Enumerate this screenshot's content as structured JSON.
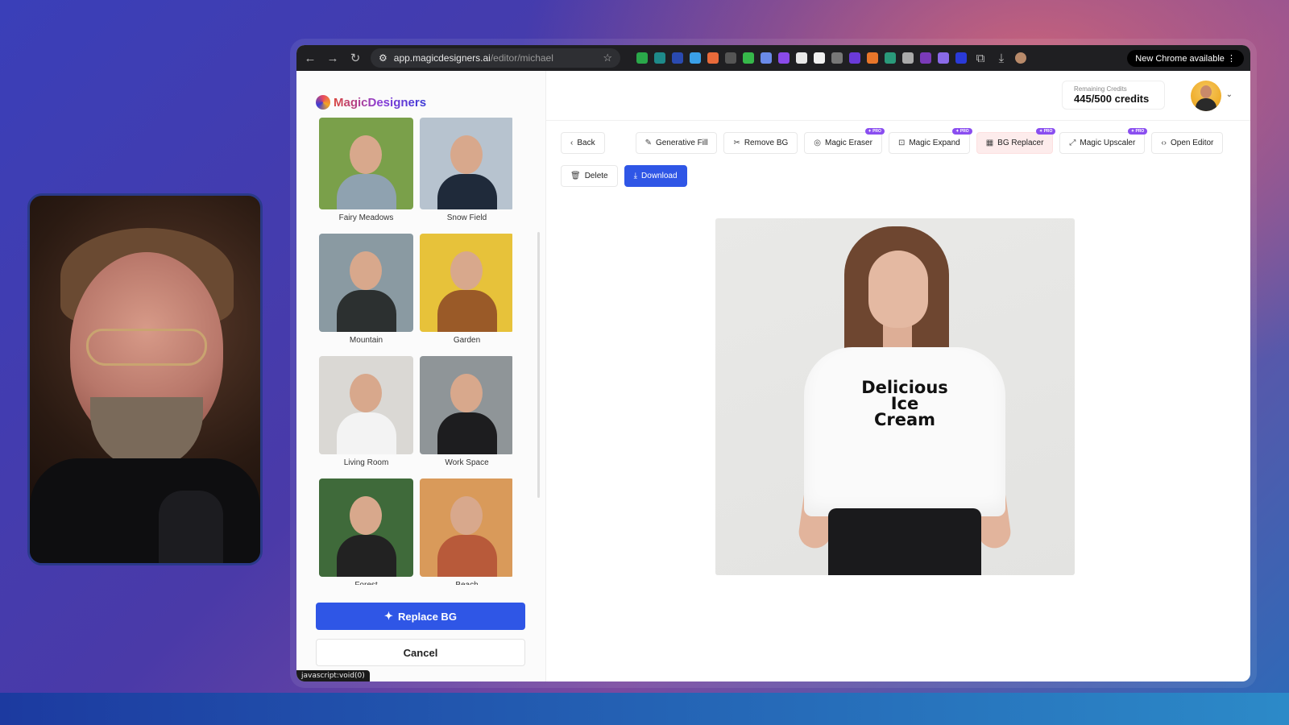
{
  "browser": {
    "url_host": "app.magicdesigners.ai",
    "url_path": "/editor/michael",
    "update_label": "New Chrome available"
  },
  "app": {
    "logo_text": "MagicDesigners"
  },
  "gallery": {
    "items": [
      {
        "label": "Fairy Meadows",
        "bg": "#7aa04a",
        "body": "#8fa2b0"
      },
      {
        "label": "Snow Field",
        "bg": "#b7c3cf",
        "body": "#1f2a3a"
      },
      {
        "label": "Mountain",
        "bg": "#8a9aa2",
        "body": "#2c3030"
      },
      {
        "label": "Garden",
        "bg": "#e7c23a",
        "body": "#9a5a28"
      },
      {
        "label": "Living Room",
        "bg": "#dad8d4",
        "body": "#f3f3f3"
      },
      {
        "label": "Work Space",
        "bg": "#8f9598",
        "body": "#1d1d1f"
      },
      {
        "label": "Forest",
        "bg": "#3f6a3a",
        "body": "#222"
      },
      {
        "label": "Beach",
        "bg": "#d99a5a",
        "body": "#b85a3a"
      }
    ],
    "replace_label": "Replace BG",
    "cancel_label": "Cancel",
    "status_link": "javascript:void(0)"
  },
  "header": {
    "credits_label": "Remaining Credits",
    "credits_value": "445/500 credits"
  },
  "toolbar": {
    "back": "Back",
    "generative_fill": "Generative Fill",
    "remove_bg": "Remove BG",
    "magic_eraser": "Magic Eraser",
    "magic_expand": "Magic Expand",
    "bg_replacer": "BG Replacer",
    "magic_upscaler": "Magic Upscaler",
    "open_editor": "Open Editor",
    "pro_badge": "✦ PRO",
    "delete": "Delete",
    "download": "Download"
  },
  "canvas": {
    "shirt_line1": "Delicious",
    "shirt_line2": "Ice",
    "shirt_line3": "Cream"
  }
}
